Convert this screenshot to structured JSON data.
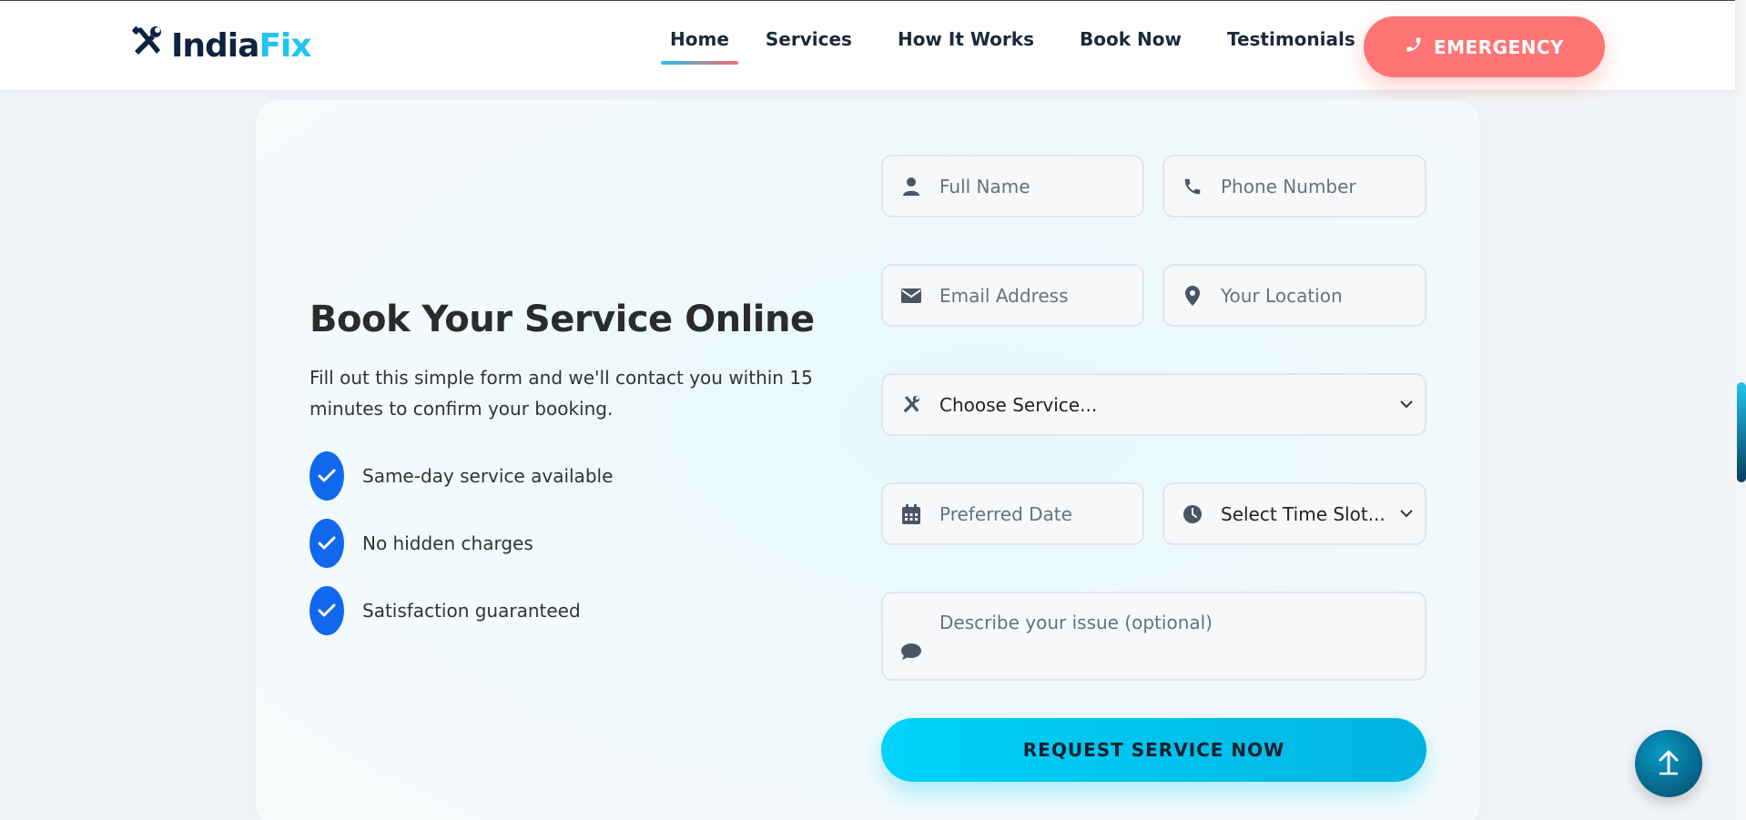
{
  "brand": {
    "name_part1": "India",
    "name_part2": "Fix"
  },
  "nav": {
    "items": [
      {
        "label": "Home",
        "active": true
      },
      {
        "label": "Services",
        "active": false
      },
      {
        "label": "How It Works",
        "active": false
      },
      {
        "label": "Book Now",
        "active": false
      },
      {
        "label": "Testimonials",
        "active": false
      }
    ],
    "emergency_label": "EMERGENCY"
  },
  "booking": {
    "title": "Book Your Service Online",
    "subtitle": "Fill out this simple form and we'll contact you within 15 minutes to confirm your booking.",
    "features": [
      "Same-day service available",
      "No hidden charges",
      "Satisfaction guaranteed"
    ]
  },
  "form": {
    "full_name_placeholder": "Full Name",
    "phone_placeholder": "Phone Number",
    "email_placeholder": "Email Address",
    "location_placeholder": "Your Location",
    "service_select": "Choose Service...",
    "date_placeholder": "Preferred Date",
    "time_select": "Select Time Slot...",
    "issue_placeholder": "Describe your issue (optional)",
    "submit_label": "REQUEST SERVICE NOW"
  },
  "colors": {
    "brand_dark": "#0e2340",
    "brand_accent": "#1fc4f0",
    "emergency": "#ff7474",
    "check_blue": "#1167ee",
    "submit": "#00c8f0"
  },
  "icons": {
    "logo": "tools-icon",
    "emergency": "phone-icon",
    "name": "user-icon",
    "phone": "phone-icon",
    "email": "envelope-icon",
    "location": "map-pin-icon",
    "service": "tools-icon",
    "date": "calendar-icon",
    "time": "clock-icon",
    "issue": "comment-icon",
    "scroll_top": "arrow-up-icon"
  }
}
